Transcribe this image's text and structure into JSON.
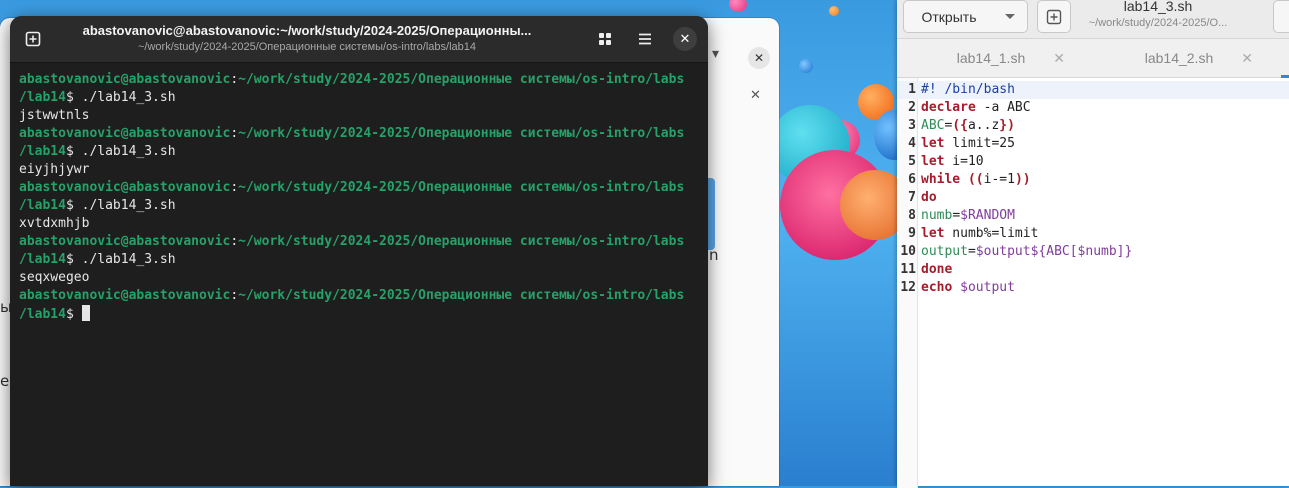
{
  "terminal": {
    "title": "abastovanovic@abastovanovic:~/work/study/2024-2025/Операционны...",
    "subtitle": "~/work/study/2024-2025/Операционные системы/os-intro/labs/lab14",
    "lines": [
      {
        "prompt": "abastovanovic@abastovanovic",
        "path": "~/work/study/2024-2025/Операционные системы/os-intro/labs"
      },
      {
        "prompt": "/lab14",
        "rest": "$ ./lab14_3.sh"
      },
      {
        "text": "jstwwtnls"
      },
      {
        "prompt": "abastovanovic@abastovanovic",
        "path": "~/work/study/2024-2025/Операционные системы/os-intro/labs"
      },
      {
        "prompt": "/lab14",
        "rest": "$ ./lab14_3.sh"
      },
      {
        "text": "eiyjhjywr"
      },
      {
        "prompt": "abastovanovic@abastovanovic",
        "path": "~/work/study/2024-2025/Операционные системы/os-intro/labs"
      },
      {
        "prompt": "/lab14",
        "rest": "$ ./lab14_3.sh"
      },
      {
        "text": "xvtdxmhjb"
      },
      {
        "prompt": "abastovanovic@abastovanovic",
        "path": "~/work/study/2024-2025/Операционные системы/os-intro/labs"
      },
      {
        "prompt": "/lab14",
        "rest": "$ ./lab14_3.sh"
      },
      {
        "text": "seqxwegeo"
      },
      {
        "prompt": "abastovanovic@abastovanovic",
        "path": "~/work/study/2024-2025/Операционные системы/os-intro/labs"
      },
      {
        "prompt": "/lab14",
        "rest": "$ "
      }
    ]
  },
  "browser": {
    "edge_text_1": "ы",
    "edge_text_2": "ен",
    "edge_text_3": "n",
    "close_1": "✕",
    "close_2": "✕",
    "dropdown": "▾"
  },
  "editor": {
    "open_label": "Открыть",
    "title": "lab14_3.sh",
    "subtitle": "~/work/study/2024-2025/О...",
    "tabs": [
      {
        "label": "lab14_1.sh"
      },
      {
        "label": "lab14_2.sh"
      }
    ],
    "code_lines": [
      {
        "n": "1",
        "parts": [
          [
            "path",
            "#! /bin/bash"
          ]
        ]
      },
      {
        "n": "2",
        "parts": [
          [
            "kw",
            "declare"
          ],
          [
            "",
            " -a ABC"
          ]
        ]
      },
      {
        "n": "3",
        "parts": [
          [
            "var",
            "ABC"
          ],
          [
            "",
            "="
          ],
          [
            "sym",
            "({"
          ],
          [
            "",
            "a..z"
          ],
          [
            "sym",
            "})"
          ]
        ]
      },
      {
        "n": "4",
        "parts": [
          [
            "kw",
            "let"
          ],
          [
            "",
            " limit=25"
          ]
        ]
      },
      {
        "n": "5",
        "parts": [
          [
            "kw",
            "let"
          ],
          [
            "",
            " i=10"
          ]
        ]
      },
      {
        "n": "6",
        "parts": [
          [
            "kw",
            "while"
          ],
          [
            "",
            " "
          ],
          [
            "sym",
            "(("
          ],
          [
            "",
            "i-=1"
          ],
          [
            "sym",
            "))"
          ]
        ]
      },
      {
        "n": "7",
        "parts": [
          [
            "kw",
            "do"
          ]
        ]
      },
      {
        "n": "8",
        "parts": [
          [
            "var",
            "numb"
          ],
          [
            "",
            "="
          ],
          [
            "expand",
            "$RANDOM"
          ]
        ]
      },
      {
        "n": "9",
        "parts": [
          [
            "kw",
            "let"
          ],
          [
            "",
            " numb%=limit"
          ]
        ]
      },
      {
        "n": "10",
        "parts": [
          [
            "var",
            "output"
          ],
          [
            "",
            "="
          ],
          [
            "expand",
            "$output${ABC[$numb]}"
          ]
        ]
      },
      {
        "n": "11",
        "parts": [
          [
            "kw",
            "done"
          ]
        ]
      },
      {
        "n": "12",
        "parts": [
          [
            "kw",
            "echo"
          ],
          [
            "",
            " "
          ],
          [
            "expand",
            "$output"
          ]
        ]
      }
    ]
  },
  "colors": {
    "prompt_green": "#26a269",
    "keyword_red": "#a51d2d",
    "accent_blue": "#3584e4"
  }
}
